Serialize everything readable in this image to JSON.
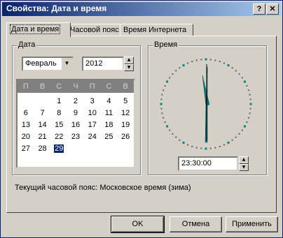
{
  "window": {
    "title": "Свойства: Дата и время",
    "help_btn": "?",
    "close_btn": "✕"
  },
  "tabs": [
    {
      "label": "Дата и время",
      "active": true
    },
    {
      "label": "Часовой пояс",
      "active": false
    },
    {
      "label": "Время Интернета",
      "active": false
    }
  ],
  "date_group": {
    "label": "Дата",
    "month": "Февраль",
    "year": "2012",
    "weekdays": [
      "П",
      "В",
      "С",
      "Ч",
      "П",
      "С",
      "В"
    ],
    "days": [
      "",
      "",
      "1",
      "2",
      "3",
      "4",
      "5",
      "6",
      "7",
      "8",
      "9",
      "10",
      "11",
      "12",
      "13",
      "14",
      "15",
      "16",
      "17",
      "18",
      "19",
      "20",
      "21",
      "22",
      "23",
      "24",
      "25",
      "26",
      "27",
      "28",
      "29",
      "",
      "",
      "",
      "",
      ""
    ],
    "selected_day": "29"
  },
  "time_group": {
    "label": "Время",
    "time": "23:30:00"
  },
  "status": "Текущий часовой пояс: Московское время (зима)",
  "buttons": {
    "ok": "OK",
    "cancel": "Отмена",
    "apply": "Применить"
  }
}
